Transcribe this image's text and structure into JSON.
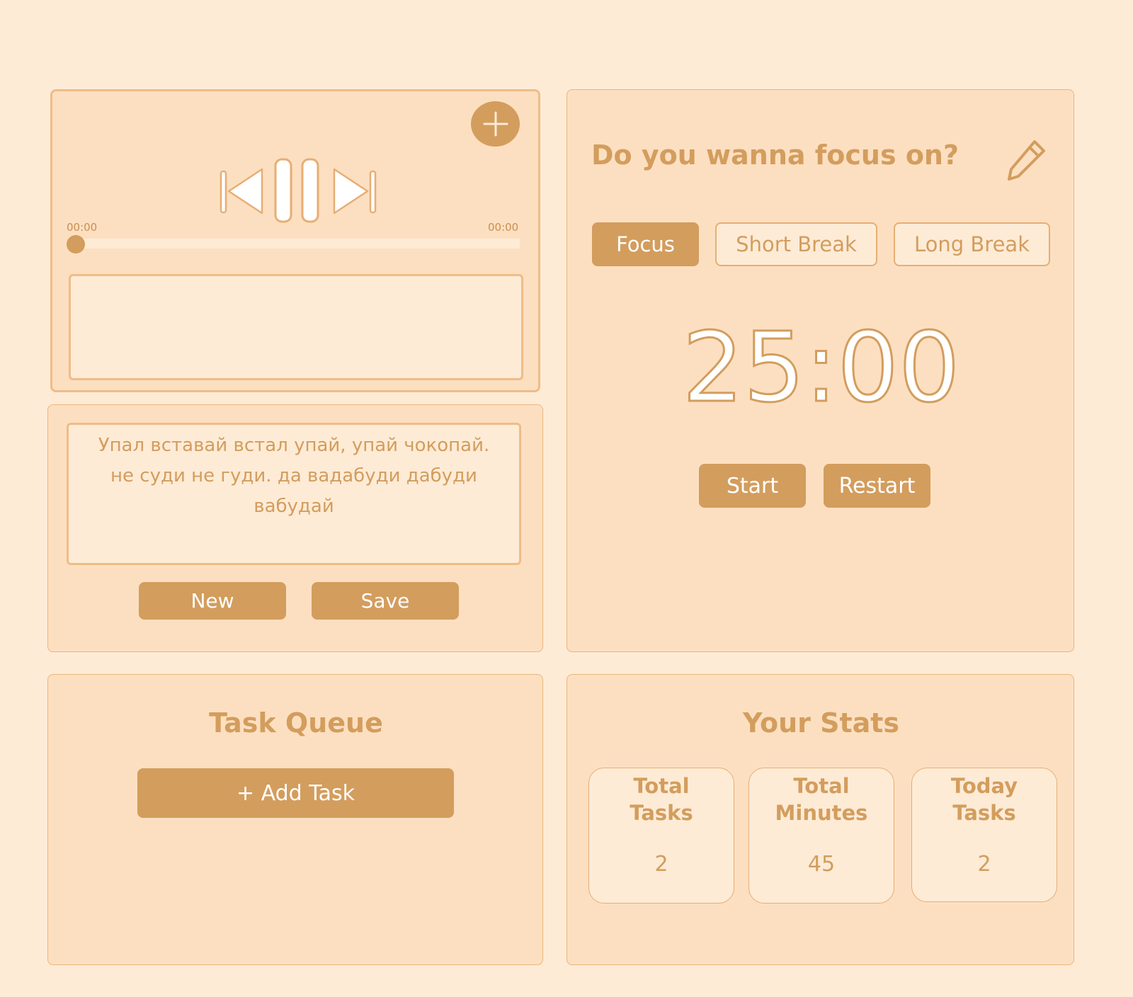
{
  "player": {
    "time_start": "00:00",
    "time_end": "00:00",
    "progress": 0,
    "icons": [
      "add-track-icon",
      "previous-track-icon",
      "pause-icon",
      "next-track-icon"
    ]
  },
  "quote": {
    "text": "Упал вставай встал упай, упай чокопай. не суди не гуди. да вадабуди дабуди вабудай",
    "new_label": "New",
    "save_label": "Save"
  },
  "timer": {
    "heading": "Do you wanna focus on?",
    "modes": [
      {
        "label": "Focus",
        "active": true
      },
      {
        "label": "Short Break",
        "active": false
      },
      {
        "label": "Long Break",
        "active": false
      }
    ],
    "time": "25:00",
    "start_label": "Start",
    "restart_label": "Restart",
    "edit_icon": "pencil-icon"
  },
  "tasks": {
    "title": "Task Queue",
    "add_label": "+ Add Task"
  },
  "stats": {
    "title": "Your Stats",
    "cards": [
      {
        "title": "Total\nTasks",
        "value": "2"
      },
      {
        "title": "Total\nMinutes",
        "value": "45"
      },
      {
        "title": "Today\nTasks",
        "value": "2"
      }
    ]
  },
  "colors": {
    "background": "#fdebd6",
    "panel": "#fcdfc1",
    "accent": "#d39d5d",
    "border": "#ebb57e"
  }
}
